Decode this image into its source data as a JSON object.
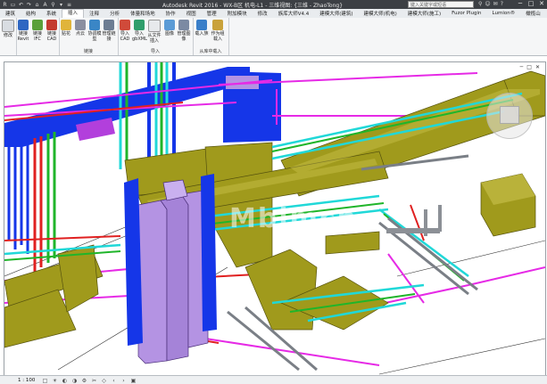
{
  "window": {
    "title": "Autodesk Revit 2016 -    WX-B区 机电-L1 - 三维视图: {三维 - ZhaoTong}",
    "search_placeholder": "键入关键字或短语",
    "controls": [
      "─",
      "□",
      "✕"
    ]
  },
  "quick_access": [
    "R",
    "▭",
    "↶",
    "↷",
    "⌂",
    "A",
    "⚲",
    "▾",
    "≡"
  ],
  "menu_tabs": [
    {
      "label": "建筑"
    },
    {
      "label": "结构"
    },
    {
      "label": "系统"
    },
    {
      "label": "插入",
      "active": true
    },
    {
      "label": "注释"
    },
    {
      "label": "分析"
    },
    {
      "label": "体量和场地"
    },
    {
      "label": "协作"
    },
    {
      "label": "视图"
    },
    {
      "label": "管理"
    },
    {
      "label": "附加模块"
    },
    {
      "label": "修改"
    },
    {
      "label": "族库大师V4.4"
    },
    {
      "label": "建模大师(建筑)"
    },
    {
      "label": "建模大师(机电)"
    },
    {
      "label": "建模大师(施工)"
    },
    {
      "label": "Fuzor Plugin"
    },
    {
      "label": "Lumion®"
    },
    {
      "label": "橄榄山"
    }
  ],
  "ribbon": {
    "groups": [
      {
        "label": "",
        "buttons": [
          {
            "label": "修改"
          }
        ]
      },
      {
        "label": "",
        "buttons": [
          {
            "label": "链接 Revit"
          },
          {
            "label": "链接 IFC"
          },
          {
            "label": "链接 CAD"
          }
        ]
      },
      {
        "label": "链接",
        "buttons": [
          {
            "label": "贴花"
          },
          {
            "label": "点云"
          },
          {
            "label": "协调模型"
          },
          {
            "label": "管理链接"
          }
        ]
      },
      {
        "label": "导入",
        "buttons": [
          {
            "label": "导入 CAD"
          },
          {
            "label": "导入 gbXML"
          },
          {
            "label": "从文件插入"
          },
          {
            "label": "图像"
          },
          {
            "label": "管理图像"
          }
        ]
      },
      {
        "label": "从库中载入",
        "buttons": [
          {
            "label": "载入族"
          },
          {
            "label": "作为组载入"
          }
        ]
      }
    ]
  },
  "viewport": {
    "watermark": "Mbimcn",
    "window_controls": [
      "─",
      "□",
      "✕"
    ]
  },
  "status": {
    "scale": "1 : 100",
    "view_icons": [
      "□",
      "☀",
      "◐",
      "◑",
      "⚙",
      "✂",
      "◇",
      "‹",
      "›",
      "▣"
    ]
  },
  "colors": {
    "duct_olive": "#a09a1c",
    "pipe_magenta": "#e62ae6",
    "pipe_blue": "#1536e8",
    "pipe_cyan": "#20d8d8",
    "pipe_red": "#e02020",
    "pipe_green": "#1fb52a",
    "riser_violet": "#b493e3"
  }
}
